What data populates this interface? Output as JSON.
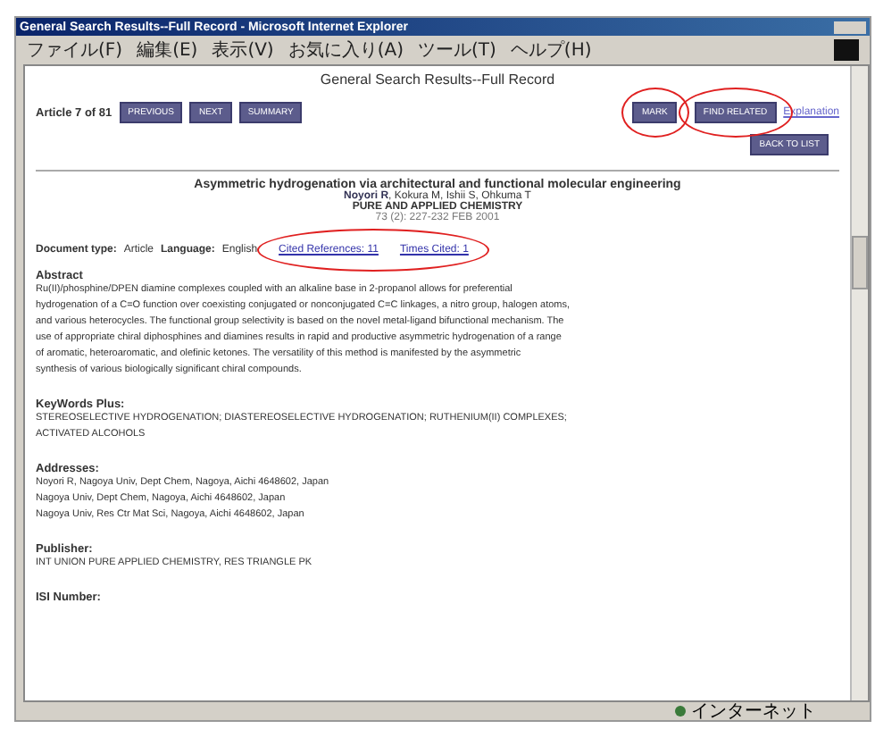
{
  "window": {
    "title": "General Search Results--Full Record - Microsoft Internet Explorer"
  },
  "menu": [
    "ファイル(F)",
    "編集(E)",
    "表示(V)",
    "お気に入り(A)",
    "ツール(T)",
    "ヘルプ(H)"
  ],
  "page": {
    "heading": "General Search Results--Full Record",
    "counter": "Article 7 of 81",
    "nav_buttons": [
      "PREVIOUS",
      "NEXT",
      "SUMMARY"
    ],
    "action_buttons": [
      "MARK",
      "FIND RELATED"
    ],
    "link": "Explanation",
    "back_button": "BACK TO LIST"
  },
  "record": {
    "title": "Asymmetric hydrogenation via architectural and functional molecular engineering",
    "authors_label": "Noyori R",
    "authors": ", Kokura M, Ishii S, Ohkuma T",
    "journal": "PURE AND APPLIED CHEMISTRY",
    "citation": "73 (2): 227-232 FEB 2001",
    "doc_type_label": "Document type:",
    "doc_type": "Article",
    "language_label": "Language:",
    "language": "English",
    "cited_refs": "Cited References: 11",
    "times_cited": "Times Cited: 1",
    "sections": [
      {
        "heading": "Abstract",
        "lines": [
          "Ru(II)/phosphine/DPEN diamine complexes coupled with an alkaline base in 2-propanol allows for preferential",
          "hydrogenation of a C=O function over coexisting conjugated or nonconjugated C=C linkages, a nitro group, halogen atoms,",
          "and various heterocycles. The functional group selectivity is based on the novel metal-ligand bifunctional mechanism. The",
          "use of appropriate chiral diphosphines and diamines results in rapid and productive asymmetric hydrogenation of a range",
          "of aromatic, heteroaromatic, and olefinic ketones. The versatility of this method is manifested by the asymmetric",
          "synthesis of various biologically significant chiral compounds."
        ]
      },
      {
        "heading": "KeyWords Plus:",
        "lines": [
          "STEREOSELECTIVE HYDROGENATION; DIASTEREOSELECTIVE HYDROGENATION; RUTHENIUM(II) COMPLEXES;",
          "ACTIVATED ALCOHOLS"
        ]
      },
      {
        "heading": "Addresses:",
        "lines": [
          "Noyori R, Nagoya Univ, Dept Chem, Nagoya, Aichi 4648602, Japan",
          "Nagoya Univ, Dept Chem, Nagoya, Aichi 4648602, Japan",
          "Nagoya Univ, Res Ctr Mat Sci, Nagoya, Aichi 4648602, Japan"
        ]
      },
      {
        "heading": "Publisher:",
        "lines": [
          "INT UNION PURE APPLIED CHEMISTRY, RES TRIANGLE PK"
        ]
      },
      {
        "heading": "ISI Number:"
      }
    ]
  },
  "status_bar": {
    "zone": "インターネット"
  }
}
